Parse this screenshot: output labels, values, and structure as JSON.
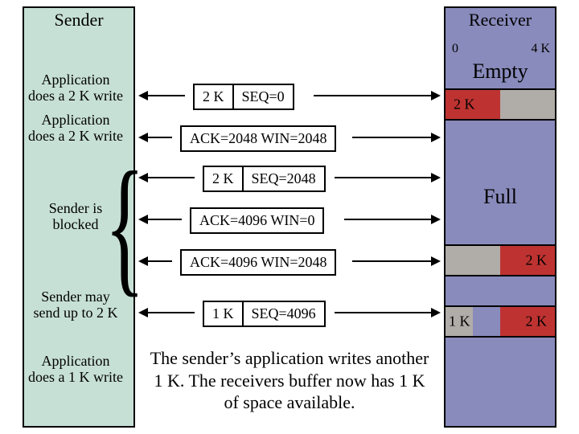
{
  "sender": {
    "title": "Sender",
    "labels": {
      "write2k_a": "Application does a 2 K write",
      "write2k_b": "Application does a 2 K write",
      "blocked": "Sender is blocked",
      "upto2k": "Sender may send up to 2 K",
      "write1k": "Application does a 1 K write"
    }
  },
  "receiver": {
    "title": "Receiver",
    "scale": {
      "left": "0",
      "right": "4 K"
    },
    "empty": "Empty",
    "full": "Full",
    "buffers": {
      "b1": {
        "left": "2 K"
      },
      "b2": {
        "right": "2 K"
      },
      "b3": {
        "left": "1 K",
        "right": "2 K"
      }
    }
  },
  "messages": {
    "seq0": {
      "size": "2 K",
      "seq": "SEQ=0"
    },
    "ack2048": "ACK=2048 WIN=2048",
    "seq2048": {
      "size": "2 K",
      "seq": "SEQ=2048"
    },
    "ack0": "ACK=4096 WIN=0",
    "ack2048b": "ACK=4096 WIN=2048",
    "seq4096": {
      "size": "1 K",
      "seq": "SEQ=4096"
    }
  },
  "caption": "The sender’s application writes another 1 K.  The receivers buffer now has 1 K of space available."
}
